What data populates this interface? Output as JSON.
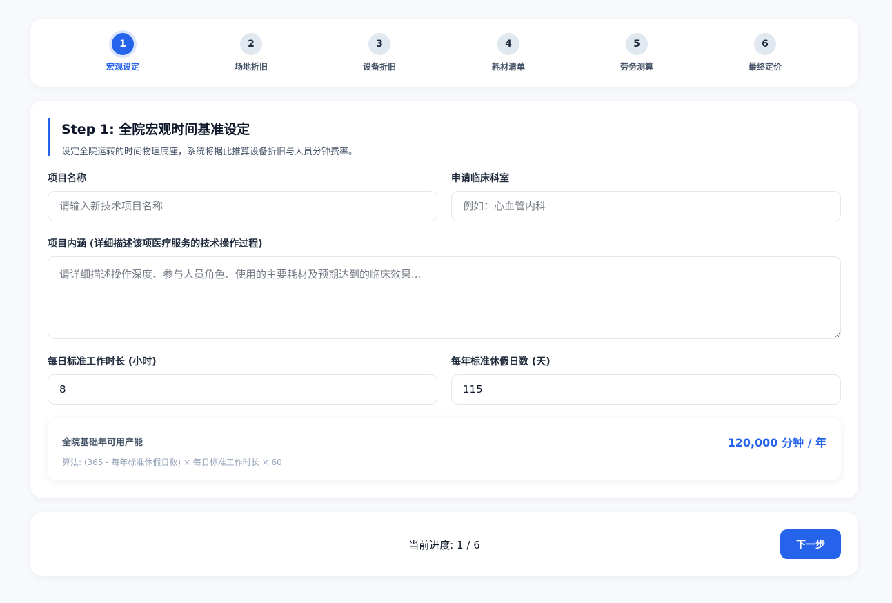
{
  "stepper": {
    "steps": [
      {
        "number": "1",
        "label": "宏观设定",
        "active": true
      },
      {
        "number": "2",
        "label": "场地折旧",
        "active": false
      },
      {
        "number": "3",
        "label": "设备折旧",
        "active": false
      },
      {
        "number": "4",
        "label": "耗材清单",
        "active": false
      },
      {
        "number": "5",
        "label": "劳务测算",
        "active": false
      },
      {
        "number": "6",
        "label": "最终定价",
        "active": false
      }
    ]
  },
  "section": {
    "title": "Step 1: 全院宏观时间基准设定",
    "description": "设定全院运转的时间物理底座，系统将据此推算设备折旧与人员分钟费率。"
  },
  "form": {
    "project_name": {
      "label": "项目名称",
      "value": "",
      "placeholder": "请输入新技术项目名称"
    },
    "department": {
      "label": "申请临床科室",
      "value": "",
      "placeholder": "例如：心血管内科"
    },
    "description": {
      "label": "项目内涵 (详细描述该项医疗服务的技术操作过程)",
      "value": "",
      "placeholder": "请详细描述操作深度、参与人员角色、使用的主要耗材及预期达到的临床效果..."
    },
    "daily_hours": {
      "label": "每日标准工作时长 (小时)",
      "value": "8"
    },
    "annual_holidays": {
      "label": "每年标准休假日数 (天)",
      "value": "115"
    }
  },
  "capacity": {
    "label": "全院基础年可用产能",
    "formula": "算法: (365 - 每年标准休假日数) × 每日标准工作时长 × 60",
    "value": "120,000 分钟 / 年"
  },
  "footer": {
    "progress": "当前进度: 1 / 6",
    "next_label": "下一步"
  },
  "colors": {
    "accent": "#2563eb",
    "background": "#f7f9fc",
    "inactive_step": "#e2e8f0"
  }
}
